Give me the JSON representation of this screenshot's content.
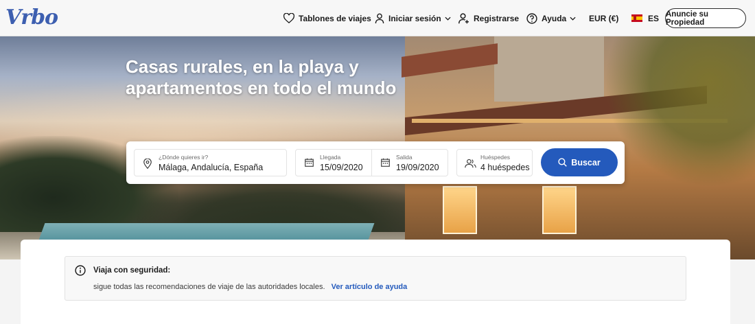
{
  "header": {
    "logo": "Vrbo",
    "nav": {
      "boards": "Tablones de viajes",
      "login": "Iniciar sesión",
      "register": "Registrarse",
      "help": "Ayuda",
      "currency": "EUR (€)",
      "language": "ES"
    },
    "cta": "Anuncie su Propiedad"
  },
  "hero": {
    "title": "Casas rurales, en la playa y apartamentos en todo el mundo"
  },
  "search": {
    "destination": {
      "label": "¿Dónde quieres ir?",
      "value": "Málaga, Andalucía, España"
    },
    "checkin": {
      "label": "Llegada",
      "value": "15/09/2020"
    },
    "checkout": {
      "label": "Salida",
      "value": "19/09/2020"
    },
    "guests": {
      "label": "Huéspedes",
      "value": "4 huéspedes"
    },
    "button": "Buscar"
  },
  "notice": {
    "title": "Viaja con seguridad:",
    "body": "sigue todas las recomendaciones de viaje de las autoridades locales.",
    "link": "Ver artículo de ayuda"
  },
  "colors": {
    "accent": "#245abc",
    "logo": "#3d5fb0"
  }
}
